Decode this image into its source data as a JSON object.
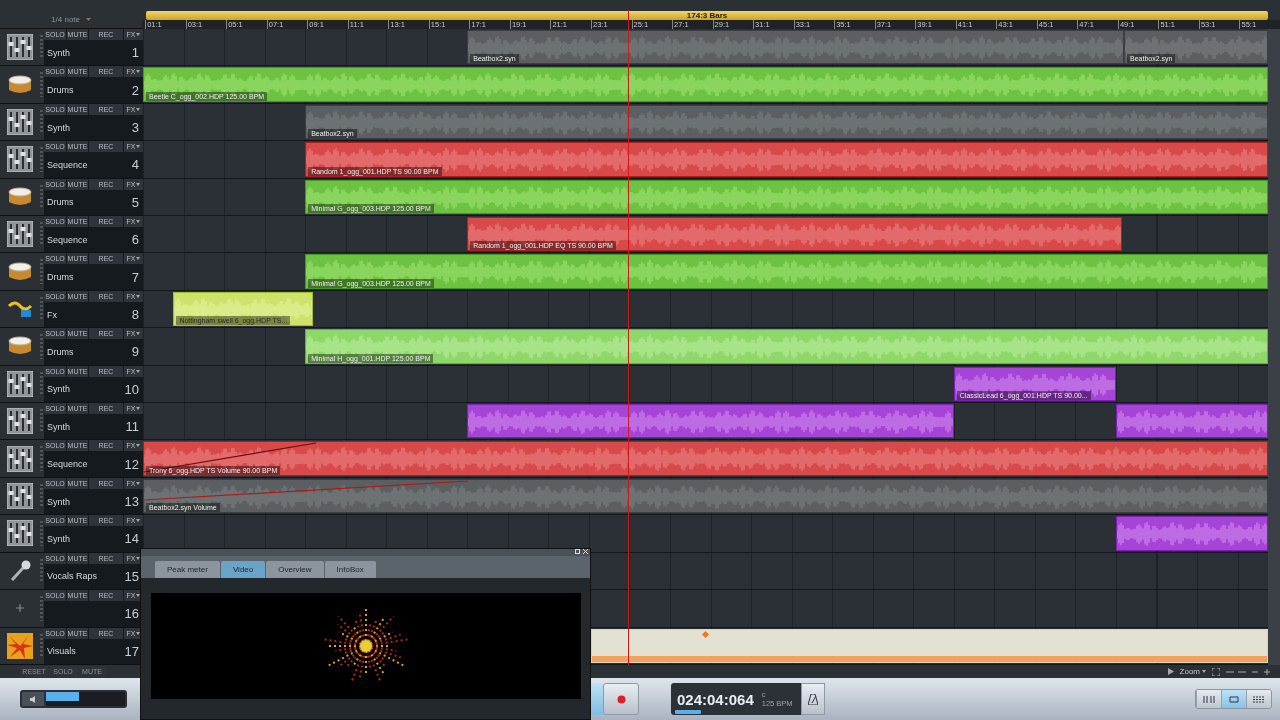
{
  "snap": {
    "label": "1/4 note"
  },
  "ruler": {
    "length_label": "174:3 Bars",
    "bar_labels": [
      "01:1",
      "03:1",
      "05:1",
      "07:1",
      "09:1",
      "11:1",
      "13:1",
      "15:1",
      "17:1",
      "19:1",
      "21:1",
      "23:1",
      "25:1",
      "27:1",
      "29:1",
      "31:1",
      "33:1",
      "35:1",
      "37:1",
      "39:1",
      "41:1",
      "43:1",
      "45:1",
      "47:1",
      "49:1",
      "51:1",
      "53:1",
      "55:1"
    ]
  },
  "tracks": [
    {
      "name": "Synth",
      "number": "1",
      "kind": "synth",
      "buttons": [
        "SOLO",
        "MUTE",
        "REC",
        "FX"
      ],
      "clips": [
        {
          "kind": "gray",
          "label": "Beatbox2.syn"
        },
        {
          "kind": "gray",
          "label": "Beatbox2.syn"
        }
      ]
    },
    {
      "name": "Drums",
      "number": "2",
      "kind": "drums",
      "buttons": [
        "SOLO",
        "MUTE",
        "REC",
        "FX"
      ],
      "clips": [
        {
          "kind": "green",
          "label": "Beetle C_ogg_002.HDP 125.00 BPM"
        }
      ]
    },
    {
      "name": "Synth",
      "number": "3",
      "kind": "synth",
      "buttons": [
        "SOLO",
        "MUTE",
        "REC",
        "FX"
      ],
      "clips": [
        {
          "kind": "gray",
          "label": "Beatbox2.syn"
        }
      ]
    },
    {
      "name": "Sequence",
      "number": "4",
      "kind": "synth",
      "buttons": [
        "SOLO",
        "MUTE",
        "REC",
        "FX"
      ],
      "clips": [
        {
          "kind": "red",
          "label": "Random 1_ogg_001.HDP TS 90.00 BPM"
        }
      ]
    },
    {
      "name": "Drums",
      "number": "5",
      "kind": "drums",
      "buttons": [
        "SOLO",
        "MUTE",
        "REC",
        "FX"
      ],
      "clips": [
        {
          "kind": "green",
          "label": "Minimal G_ogg_003.HDP 125.00 BPM"
        }
      ]
    },
    {
      "name": "Sequence",
      "number": "6",
      "kind": "synth",
      "buttons": [
        "SOLO",
        "MUTE",
        "REC",
        "FX"
      ],
      "clips": [
        {
          "kind": "red",
          "label": "Random 1_ogg_001.HDP EQ TS 90.00 BPM"
        }
      ]
    },
    {
      "name": "Drums",
      "number": "7",
      "kind": "drums",
      "buttons": [
        "SOLO",
        "MUTE",
        "REC",
        "FX"
      ],
      "clips": [
        {
          "kind": "green",
          "label": "Minimal G_ogg_003.HDP 125.00 BPM"
        }
      ]
    },
    {
      "name": "Fx",
      "number": "8",
      "kind": "fx",
      "buttons": [
        "SOLO",
        "MUTE",
        "REC",
        "FX"
      ],
      "clips": [
        {
          "kind": "lime",
          "label": "Nottingham swell 6_ogg.HDP TS..."
        }
      ]
    },
    {
      "name": "Drums",
      "number": "9",
      "kind": "drums",
      "buttons": [
        "SOLO",
        "MUTE",
        "REC",
        "FX"
      ],
      "clips": [
        {
          "kind": "lightgreen",
          "label": "Minimal H_ogg_001.HDP 125.00 BPM"
        }
      ]
    },
    {
      "name": "Synth",
      "number": "10",
      "kind": "synth",
      "buttons": [
        "SOLO",
        "MUTE",
        "REC",
        "FX"
      ],
      "clips": [
        {
          "kind": "purple",
          "label": "ClassicLead 6_ogg_001.HDP TS 90.00..."
        }
      ]
    },
    {
      "name": "Synth",
      "number": "11",
      "kind": "synth",
      "buttons": [
        "SOLO",
        "MUTE",
        "REC",
        "FX"
      ],
      "clips": [
        {
          "kind": "purple"
        },
        {
          "kind": "purple"
        }
      ]
    },
    {
      "name": "Sequence",
      "number": "12",
      "kind": "synth",
      "buttons": [
        "SOLO",
        "MUTE",
        "REC",
        "FX"
      ],
      "clips": [
        {
          "kind": "red",
          "label": "Trony 6_ogg.HDP TS Volume 90.00 BPM"
        }
      ]
    },
    {
      "name": "Synth",
      "number": "13",
      "kind": "synth",
      "buttons": [
        "SOLO",
        "MUTE",
        "REC",
        "FX"
      ],
      "clips": [
        {
          "kind": "gray",
          "label": "Beatbox2.syn Volume"
        }
      ]
    },
    {
      "name": "Synth",
      "number": "14",
      "kind": "synth",
      "buttons": [
        "SOLO",
        "MUTE",
        "REC",
        "FX"
      ],
      "clips": [
        {
          "kind": "purple"
        }
      ]
    },
    {
      "name": "Vocals Raps",
      "number": "15",
      "kind": "vocals",
      "buttons": [
        "SOLO",
        "MUTE",
        "REC",
        "FX"
      ]
    },
    {
      "number": "16",
      "kind": "empty",
      "buttons": [
        "SOLO",
        "MUTE",
        "REC",
        "FX"
      ]
    },
    {
      "name": "Visuals",
      "number": "17",
      "kind": "visuals",
      "buttons": [
        "SOLO",
        "MUTE",
        "REC",
        "FX"
      ],
      "clips": [
        {
          "kind": "beige"
        }
      ]
    }
  ],
  "master": {
    "buttons": [
      "RESET",
      "SOLO",
      "MUTE"
    ]
  },
  "volume": {
    "level": 0.42
  },
  "panel": {
    "tabs": [
      {
        "label": "Peak meter",
        "selected": false
      },
      {
        "label": "Video",
        "selected": true
      },
      {
        "label": "Overview",
        "selected": false
      },
      {
        "label": "InfoBox",
        "selected": false
      }
    ]
  },
  "zoom": {
    "label": "Zoom"
  },
  "transport": {
    "time": "024:04:064",
    "key": "c",
    "bpm": "125 BPM"
  },
  "view_buttons": [
    {
      "selected": false
    },
    {
      "selected": true
    },
    {
      "selected": false
    }
  ]
}
